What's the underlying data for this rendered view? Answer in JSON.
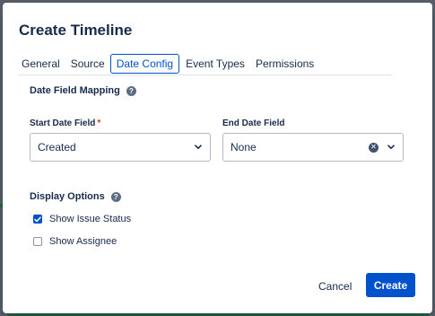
{
  "dialog": {
    "title": "Create Timeline"
  },
  "tabs": [
    {
      "label": "General",
      "active": false
    },
    {
      "label": "Source",
      "active": false
    },
    {
      "label": "Date Config",
      "active": true
    },
    {
      "label": "Event Types",
      "active": false
    },
    {
      "label": "Permissions",
      "active": false
    }
  ],
  "date_mapping": {
    "section_title": "Date Field Mapping",
    "start": {
      "label": "Start Date Field",
      "required_marker": "*",
      "value": "Created"
    },
    "end": {
      "label": "End Date Field",
      "value": "None"
    }
  },
  "display_options": {
    "section_title": "Display Options",
    "show_issue_status": {
      "label": "Show Issue Status",
      "checked": true
    },
    "show_assignee": {
      "label": "Show Assignee",
      "checked": false
    }
  },
  "footer": {
    "cancel_label": "Cancel",
    "create_label": "Create"
  },
  "colors": {
    "accent": "#0052cc",
    "text": "#172b4d",
    "required": "#de350b"
  },
  "icons": {
    "help": "question-circle-icon",
    "dropdown": "chevron-down-icon",
    "clear": "clear-x-circle-icon",
    "check": "checkmark-icon"
  }
}
